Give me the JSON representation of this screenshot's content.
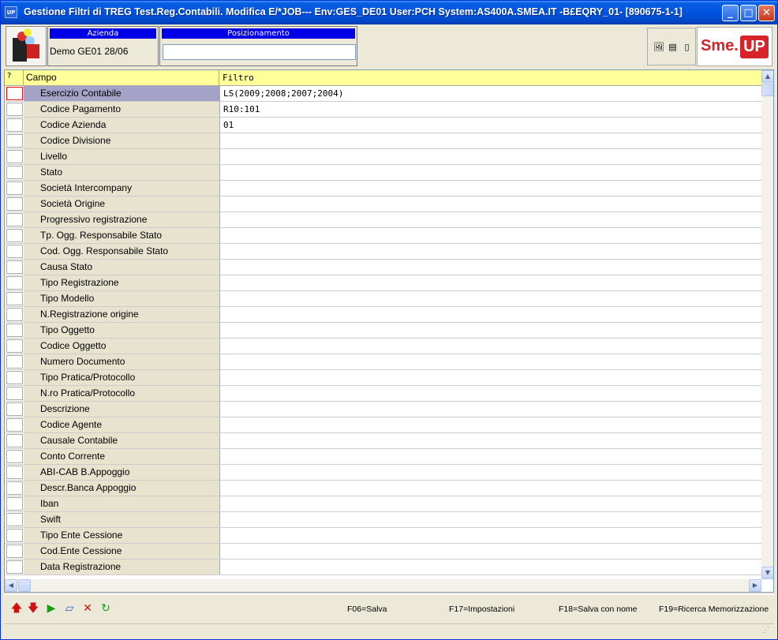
{
  "window": {
    "app_icon": "UP",
    "title": "Gestione Filtri di TREG Test.Reg.Contabili.  Modifica E/*JOB--- Env:GES_DE01 User:PCH System:AS400A.SMEA.IT -B£EQRY_01- [890675-1-1]"
  },
  "header": {
    "azienda_label": "Azienda",
    "azienda_value": "Demo GE01 28/06",
    "posizionamento_label": "Posizionamento",
    "posizionamento_value": "",
    "brand_left": "Sme.",
    "brand_right": "UP",
    "brand_color": "#d8232a"
  },
  "grid": {
    "columns": {
      "q": "?",
      "campo": "Campo",
      "filtro": "Filtro"
    },
    "rows": [
      {
        "campo": "Esercizio Contabile",
        "filtro": "LS(2009;2008;2007;2004)"
      },
      {
        "campo": "Codice Pagamento",
        "filtro": "R10:101"
      },
      {
        "campo": "Codice Azienda",
        "filtro": "01"
      },
      {
        "campo": "Codice Divisione",
        "filtro": ""
      },
      {
        "campo": "Livello",
        "filtro": ""
      },
      {
        "campo": "Stato",
        "filtro": ""
      },
      {
        "campo": "Società Intercompany",
        "filtro": ""
      },
      {
        "campo": "Società Origine",
        "filtro": ""
      },
      {
        "campo": "Progressivo registrazione",
        "filtro": ""
      },
      {
        "campo": "Tp. Ogg. Responsabile Stato",
        "filtro": ""
      },
      {
        "campo": "Cod. Ogg. Responsabile Stato",
        "filtro": ""
      },
      {
        "campo": "Causa Stato",
        "filtro": ""
      },
      {
        "campo": "Tipo Registrazione",
        "filtro": ""
      },
      {
        "campo": "Tipo Modello",
        "filtro": ""
      },
      {
        "campo": "N.Registrazione origine",
        "filtro": ""
      },
      {
        "campo": "Tipo   Oggetto",
        "filtro": ""
      },
      {
        "campo": "Codice Oggetto",
        "filtro": ""
      },
      {
        "campo": "Numero Documento",
        "filtro": ""
      },
      {
        "campo": "Tipo Pratica/Protocollo",
        "filtro": ""
      },
      {
        "campo": "N.ro Pratica/Protocollo",
        "filtro": ""
      },
      {
        "campo": "Descrizione",
        "filtro": ""
      },
      {
        "campo": "Codice Agente",
        "filtro": ""
      },
      {
        "campo": "Causale Contabile",
        "filtro": ""
      },
      {
        "campo": "Conto Corrente",
        "filtro": ""
      },
      {
        "campo": "ABI-CAB B.Appoggio",
        "filtro": ""
      },
      {
        "campo": "Descr.Banca Appoggio",
        "filtro": ""
      },
      {
        "campo": "Iban",
        "filtro": ""
      },
      {
        "campo": "Swift",
        "filtro": ""
      },
      {
        "campo": "Tipo Ente Cessione",
        "filtro": ""
      },
      {
        "campo": "Cod.Ente Cessione",
        "filtro": ""
      },
      {
        "campo": "Data Registrazione",
        "filtro": ""
      }
    ]
  },
  "footer": {
    "f06": "F06=Salva",
    "f17": "F17=Impostazioni",
    "f18": "F18=Salva con nome",
    "f19": "F19=Ricerca Memorizzazione"
  }
}
